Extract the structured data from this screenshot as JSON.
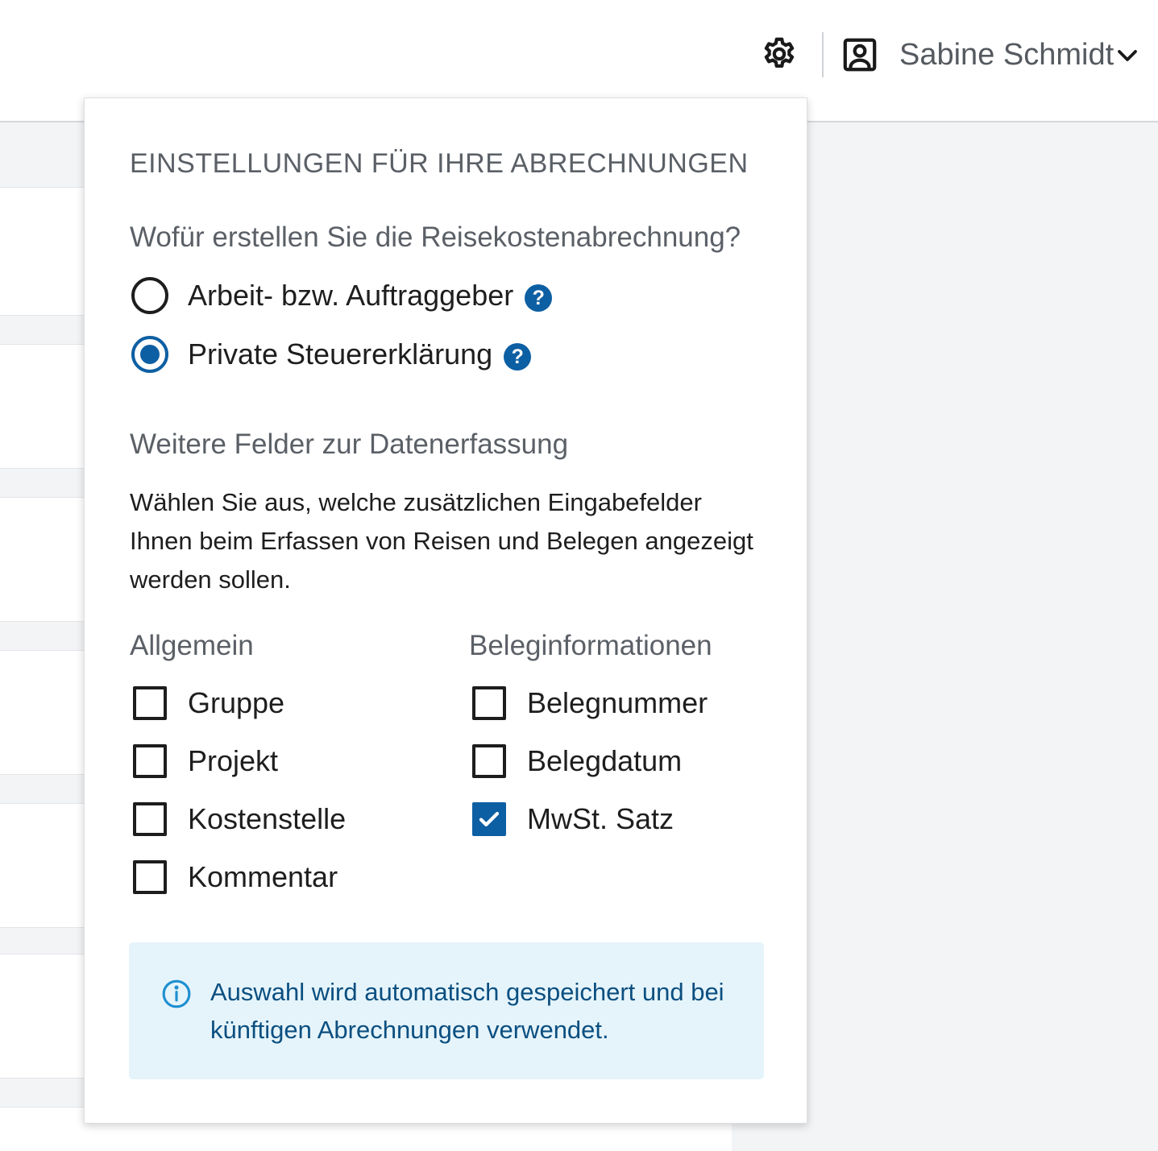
{
  "header": {
    "settings_icon": "gear-icon",
    "user_icon": "user-portrait-icon",
    "user_name": "Sabine Schmidt",
    "chevron_icon": "chevron-down-icon"
  },
  "settings_popover": {
    "title": "EINSTELLUNGEN FÜR IHRE ABRECHNUNGEN",
    "purpose_question": "Wofür erstellen Sie die Reisekostenabrechnung?",
    "purpose_options": [
      {
        "label": "Arbeit- bzw. Auftraggeber",
        "selected": false,
        "help": "?"
      },
      {
        "label": "Private Steuererklärung",
        "selected": true,
        "help": "?"
      }
    ],
    "fields_heading": "Weitere Felder zur Datenerfassung",
    "fields_description": "Wählen Sie aus, welche zusätzlichen Eingabefelder Ihnen beim Erfassen von Reisen und Belegen angezeigt werden sollen.",
    "general": {
      "heading": "Allgemein",
      "items": [
        {
          "label": "Gruppe",
          "checked": false
        },
        {
          "label": "Projekt",
          "checked": false
        },
        {
          "label": "Kostenstelle",
          "checked": false
        },
        {
          "label": "Kommentar",
          "checked": false
        }
      ]
    },
    "receipt_info": {
      "heading": "Beleginformationen",
      "items": [
        {
          "label": "Belegnummer",
          "checked": false
        },
        {
          "label": "Belegdatum",
          "checked": false
        },
        {
          "label": "MwSt. Satz",
          "checked": true
        }
      ]
    },
    "info_note": "Auswahl wird automatisch gespeichert und bei künftigen Abrechnungen verwendet."
  },
  "colors": {
    "accent": "#0d5fa3",
    "info_background": "#e5f4fb",
    "info_text": "#0b4f80",
    "page_background": "#f3f4f6"
  }
}
